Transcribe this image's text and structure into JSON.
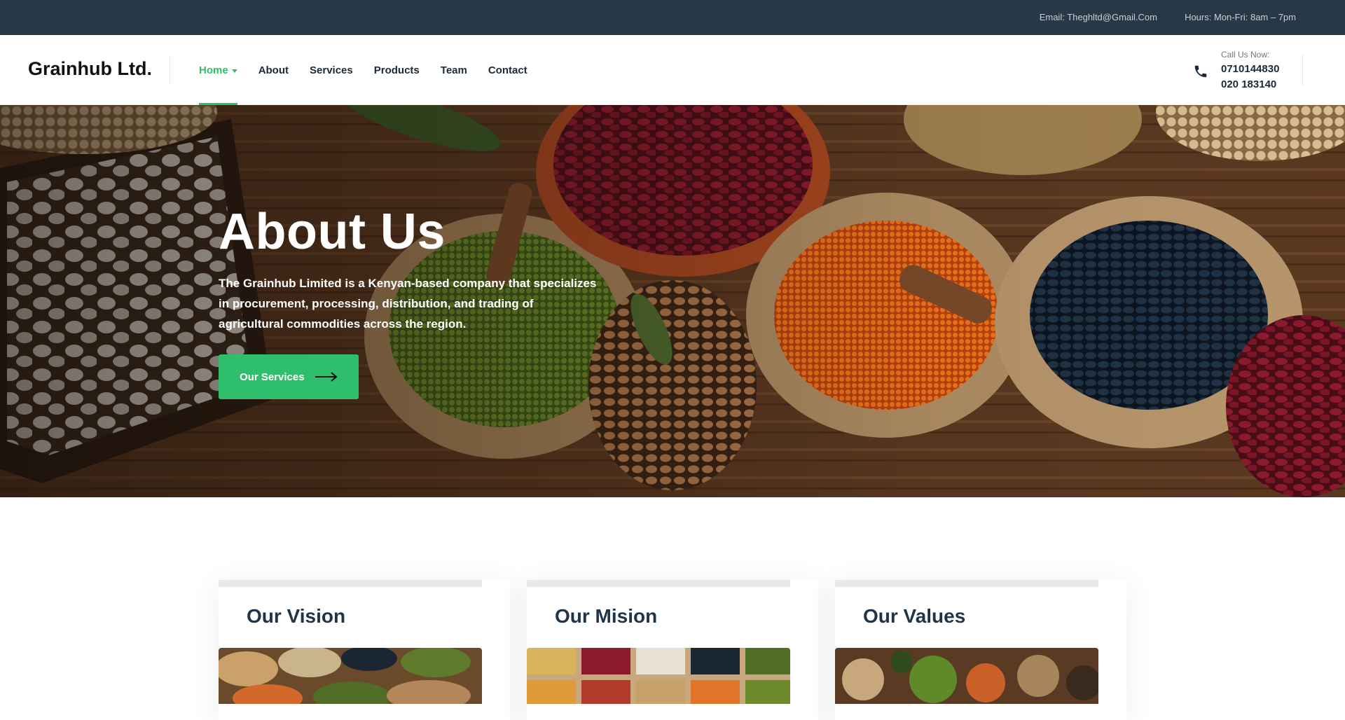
{
  "topbar": {
    "email": "Email: Theghltd@Gmail.Com",
    "hours": "Hours: Mon-Fri: 8am – 7pm"
  },
  "header": {
    "logo": "Grainhub Ltd.",
    "nav": [
      {
        "label": "Home",
        "active": true
      },
      {
        "label": "About"
      },
      {
        "label": "Services"
      },
      {
        "label": "Products"
      },
      {
        "label": "Team"
      },
      {
        "label": "Contact"
      }
    ],
    "call": {
      "label": "Call Us Now:",
      "number1": "0710144830",
      "number2": "020 183140",
      "icon": "phone-icon"
    }
  },
  "hero": {
    "title": "About Us",
    "text": "The Grainhub Limited is a Kenyan-based company that specializes in procurement, processing, distribution, and trading of agricultural commodities across the region.",
    "button_label": "Our Services",
    "button_icon": "arrow-right-icon"
  },
  "cards": [
    {
      "title": "Our Vision"
    },
    {
      "title": "Our Mision"
    },
    {
      "title": "Our Values"
    }
  ],
  "colors": {
    "accent": "#2fbf6c",
    "topbar": "#273847",
    "heading": "#1f3447"
  }
}
